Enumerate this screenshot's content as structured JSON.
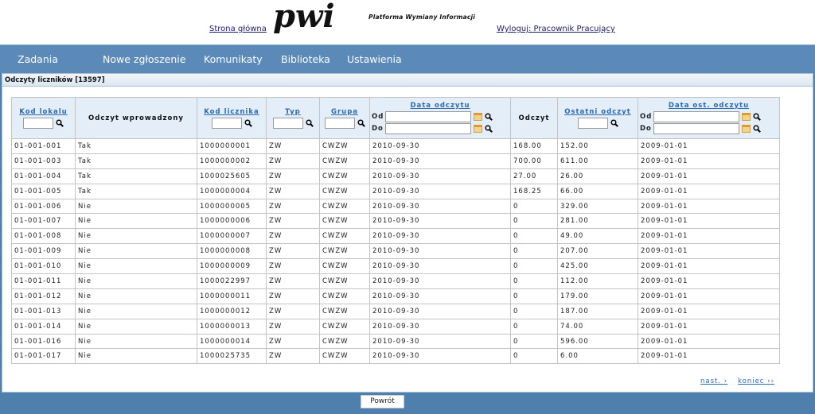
{
  "header": {
    "home_link": "Strona główna",
    "logo_text": "pwi",
    "logo_subtitle": "Platforma Wymiany Informacji",
    "logout_link": "Wyloguj: Pracownik Pracujący"
  },
  "nav": {
    "items": [
      "Zadania",
      "Nowe zgłoszenie",
      "Komunikaty",
      "Biblioteka",
      "Ustawienia"
    ]
  },
  "panel": {
    "title": "Odczyty liczników [13597]"
  },
  "table": {
    "headers": {
      "kod_lokalu": "Kod lokalu",
      "odczyt_wprowadzony": "Odczyt wprowadzony",
      "kod_licznika": "Kod licznika",
      "typ": "Typ",
      "grupa": "Grupa",
      "data_odczytu": "Data odczytu",
      "odczyt": "Odczyt",
      "ostatni_odczyt": "Ostatni odczyt",
      "data_ost_odczytu": "Data ost. odczytu",
      "od": "Od",
      "do": "Do"
    },
    "rows": [
      [
        "01-001-001",
        "Tak",
        "1000000001",
        "ZW",
        "CWZW",
        "2010-09-30",
        "168.00",
        "152.00",
        "2009-01-01"
      ],
      [
        "01-001-003",
        "Tak",
        "1000000002",
        "ZW",
        "CWZW",
        "2010-09-30",
        "700.00",
        "611.00",
        "2009-01-01"
      ],
      [
        "01-001-004",
        "Tak",
        "1000025605",
        "ZW",
        "CWZW",
        "2010-09-30",
        "27.00",
        "26.00",
        "2009-01-01"
      ],
      [
        "01-001-005",
        "Tak",
        "1000000004",
        "ZW",
        "CWZW",
        "2010-09-30",
        "168.25",
        "66.00",
        "2009-01-01"
      ],
      [
        "01-001-006",
        "Nie",
        "1000000005",
        "ZW",
        "CWZW",
        "2010-09-30",
        "0",
        "329.00",
        "2009-01-01"
      ],
      [
        "01-001-007",
        "Nie",
        "1000000006",
        "ZW",
        "CWZW",
        "2010-09-30",
        "0",
        "281.00",
        "2009-01-01"
      ],
      [
        "01-001-008",
        "Nie",
        "1000000007",
        "ZW",
        "CWZW",
        "2010-09-30",
        "0",
        "49.00",
        "2009-01-01"
      ],
      [
        "01-001-009",
        "Nie",
        "1000000008",
        "ZW",
        "CWZW",
        "2010-09-30",
        "0",
        "207.00",
        "2009-01-01"
      ],
      [
        "01-001-010",
        "Nie",
        "1000000009",
        "ZW",
        "CWZW",
        "2010-09-30",
        "0",
        "425.00",
        "2009-01-01"
      ],
      [
        "01-001-011",
        "Nie",
        "1000022997",
        "ZW",
        "CWZW",
        "2010-09-30",
        "0",
        "112.00",
        "2009-01-01"
      ],
      [
        "01-001-012",
        "Nie",
        "1000000011",
        "ZW",
        "CWZW",
        "2010-09-30",
        "0",
        "179.00",
        "2009-01-01"
      ],
      [
        "01-001-013",
        "Nie",
        "1000000012",
        "ZW",
        "CWZW",
        "2010-09-30",
        "0",
        "187.00",
        "2009-01-01"
      ],
      [
        "01-001-014",
        "Nie",
        "1000000013",
        "ZW",
        "CWZW",
        "2010-09-30",
        "0",
        "74.00",
        "2009-01-01"
      ],
      [
        "01-001-016",
        "Nie",
        "1000000014",
        "ZW",
        "CWZW",
        "2010-09-30",
        "0",
        "596.00",
        "2009-01-01"
      ],
      [
        "01-001-017",
        "Nie",
        "1000025735",
        "ZW",
        "CWZW",
        "2010-09-30",
        "0",
        "6.00",
        "2009-01-01"
      ]
    ]
  },
  "pager": {
    "next": "nast. ›",
    "last": "koniec ››"
  },
  "footer": {
    "back_button": "Powrót"
  },
  "colors": {
    "background": "#4f7fac",
    "nav": "#5b89b8",
    "link": "#2a6ab0",
    "header_cell": "#e4eef8"
  }
}
